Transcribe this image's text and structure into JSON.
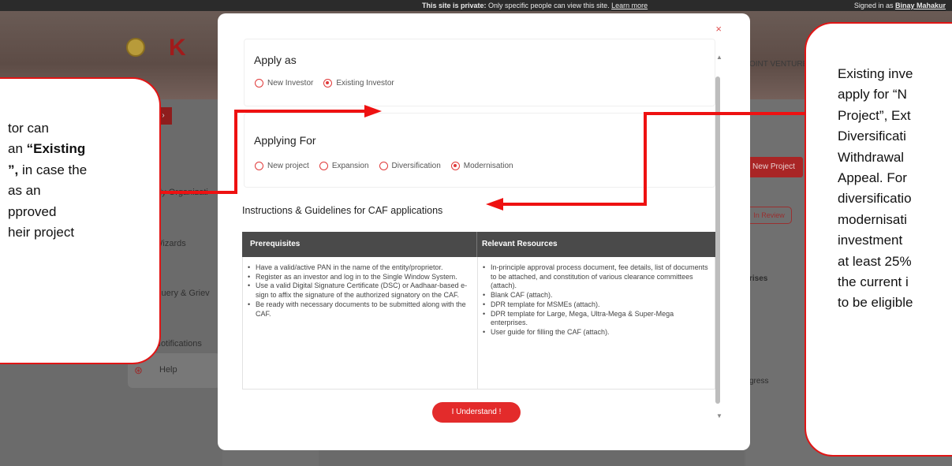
{
  "banner": {
    "private_bold": "This site is private:",
    "private_rest": " Only specific people can view this site. ",
    "learn_more": "Learn more",
    "signed_in_prefix": "Signed in as ",
    "signed_in_user": "Binay Mahakur"
  },
  "background": {
    "joint_venture": "OINT VENTURE",
    "sidebar": {
      "my_organization": "My Organizati",
      "wizards": "Wizards",
      "query": "Query & Griev",
      "notifications": "Notifications",
      "help": "Help"
    },
    "new_project": "New Project",
    "in_review": "In Review",
    "rises": "rises",
    "progress": "gress"
  },
  "modal": {
    "close": "×",
    "apply_as": {
      "title": "Apply as",
      "options": [
        {
          "label": "New Investor",
          "checked": false
        },
        {
          "label": "Existing Investor",
          "checked": true
        }
      ]
    },
    "applying_for": {
      "title": "Applying For",
      "options": [
        {
          "label": "New project",
          "checked": false
        },
        {
          "label": "Expansion",
          "checked": false
        },
        {
          "label": "Diversification",
          "checked": false
        },
        {
          "label": "Modernisation",
          "checked": true
        }
      ]
    },
    "instructions_title": "Instructions & Guidelines for CAF applications",
    "table": {
      "headers": [
        "Prerequisites",
        "Relevant Resources"
      ],
      "prerequisites": [
        "Have a valid/active PAN in the name of the entity/proprietor.",
        "Register as an investor and log in to the Single Window System.",
        "Use a valid Digital Signature Certificate (DSC) or Aadhaar-based e-sign to affix the signature of the authorized signatory on the CAF.",
        "Be ready with necessary documents to be submitted along with the CAF."
      ],
      "resources": [
        "In-principle approval process document, fee details, list of documents to be attached, and constitution of various clearance committees (attach).",
        "Blank CAF (attach).",
        "DPR template for MSMEs (attach).",
        "DPR template for Large, Mega, Ultra-Mega & Super-Mega enterprises.",
        "User guide for filling the CAF (attach)."
      ]
    },
    "understand_button": "I Understand !"
  },
  "callouts": {
    "left": {
      "line1": "tor can",
      "line2_pre": "an ",
      "line2_bold": "“Existing",
      "line3_bold": "”,",
      "line3_rest": " in case the",
      "line4": "as an",
      "line5": "pproved",
      "line6": "heir project"
    },
    "right": {
      "lines": [
        "Existing inve",
        "apply for “N",
        "Project”, Ext",
        "Diversificati",
        "Withdrawal",
        "Appeal. For",
        "diversificatio",
        "modernisati",
        "investment",
        "at least 25%",
        "the current i",
        "to be eligible"
      ]
    }
  },
  "colors": {
    "accent_red": "#e32b2b",
    "arrow_red": "#ee1111",
    "table_header": "#4a4a4a"
  }
}
